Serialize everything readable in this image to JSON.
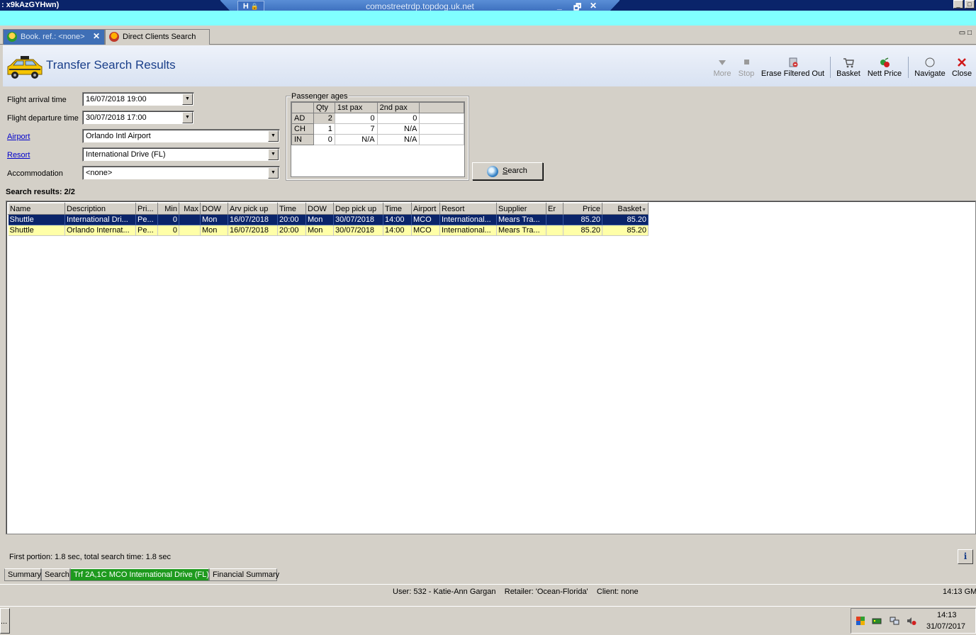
{
  "window": {
    "title": ": x9kAzGYHwn)",
    "rdp_host": "comostreetrdp.topdog.uk.net",
    "rdp_pin": "H",
    "rdp_lock": "🔒",
    "rdp_min": "_",
    "rdp_restore": "🗗",
    "rdp_close": "✕",
    "min": "_",
    "max": "□"
  },
  "tabs": [
    {
      "label": "Book. ref.: <none>",
      "close": "✕"
    },
    {
      "label": "Direct Clients Search"
    }
  ],
  "tab_restore": "▭ □",
  "header": {
    "title": "Transfer Search Results"
  },
  "toolbar": {
    "more": "More",
    "stop": "Stop",
    "erase": "Erase Filtered Out",
    "basket": "Basket",
    "nett_price": "Nett Price",
    "navigate": "Navigate",
    "close": "Close"
  },
  "form": {
    "arrival_label": "Flight arrival time",
    "arrival_value": "16/07/2018 19:00",
    "departure_label": "Flight departure time",
    "departure_value": "30/07/2018 17:00",
    "airport_label": "Airport",
    "airport_value": "Orlando Intl Airport",
    "resort_label": "Resort",
    "resort_value": "International Drive (FL)",
    "accommodation_label": "Accommodation",
    "accommodation_value": "<none>",
    "dropdown_glyph": "▼"
  },
  "passenger_ages": {
    "caption": "Passenger ages",
    "headers": [
      "",
      "Qty",
      "1st pax",
      "2nd pax",
      ""
    ],
    "rows": [
      {
        "type": "AD",
        "qty": "2",
        "pax1": "0",
        "pax2": "0"
      },
      {
        "type": "CH",
        "qty": "1",
        "pax1": "7",
        "pax2": "N/A"
      },
      {
        "type": "IN",
        "qty": "0",
        "pax1": "N/A",
        "pax2": "N/A"
      }
    ]
  },
  "search_button": {
    "label_underlined": "S",
    "label_rest": "earch"
  },
  "results": {
    "count_label": "Search results: 2/2",
    "columns": [
      "Name",
      "Description",
      "Pri...",
      "Min",
      "Max",
      "DOW",
      "Arv pick up",
      "Time",
      "DOW",
      "Dep pick up",
      "Time",
      "Airport",
      "Resort",
      "Supplier",
      "Er",
      "Price",
      "Basket"
    ],
    "rows": [
      [
        "Shuttle",
        "International Dri...",
        "Pe...",
        "0",
        "",
        "Mon",
        "16/07/2018",
        "20:00",
        "Mon",
        "30/07/2018",
        "14:00",
        "MCO",
        "International...",
        "Mears Tra...",
        "",
        "85.20",
        "85.20"
      ],
      [
        "Shuttle",
        "Orlando Internat...",
        "Pe...",
        "0",
        "",
        "Mon",
        "16/07/2018",
        "20:00",
        "Mon",
        "30/07/2018",
        "14:00",
        "MCO",
        "International...",
        "Mears Tra...",
        "",
        "85.20",
        "85.20"
      ]
    ]
  },
  "timing": "First portion: 1.8 sec, total search time: 1.8 sec",
  "info_glyph": "i",
  "bottom_tabs": [
    "Summary",
    "Search",
    "Trf 2A,1C MCO International Drive (FL)",
    "Financial Summary"
  ],
  "status": {
    "text": "User: 532 - Katie-Ann Gargan    Retailer: 'Ocean-Florida'    Client: none",
    "time": "14:13 GM"
  },
  "taskbar": {
    "start_stub": "...",
    "clock_time": "14:13",
    "clock_date": "31/07/2017"
  }
}
